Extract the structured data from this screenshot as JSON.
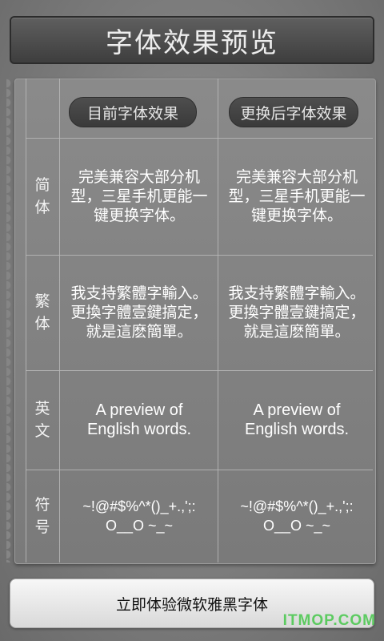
{
  "header": {
    "title": "字体效果预览"
  },
  "columns": {
    "current": "目前字体效果",
    "replaced": "更换后字体效果"
  },
  "rows": [
    {
      "label": [
        "简",
        "体"
      ],
      "current": "完美兼容大部分机型，三星手机更能一键更换字体。",
      "replaced": "完美兼容大部分机型，三星手机更能一键更换字体。"
    },
    {
      "label": [
        "繁",
        "体"
      ],
      "current": "我支持繁體字輸入。更換字體壹鍵搞定，就是這麽簡單。",
      "replaced": "我支持繁體字輸入。更換字體壹鍵搞定，就是這麽簡單。"
    },
    {
      "label": [
        "英",
        "文"
      ],
      "current": "A preview of English words.",
      "replaced": "A preview of English words."
    },
    {
      "label": [
        "符",
        "号"
      ],
      "current": "~!@#$%^*()_+.,';: O__O ~_~",
      "replaced": "~!@#$%^*()_+.,';: O__O ~_~"
    }
  ],
  "action": {
    "label": "立即体验微软雅黑字体"
  },
  "watermark": "ITMOP.COM"
}
